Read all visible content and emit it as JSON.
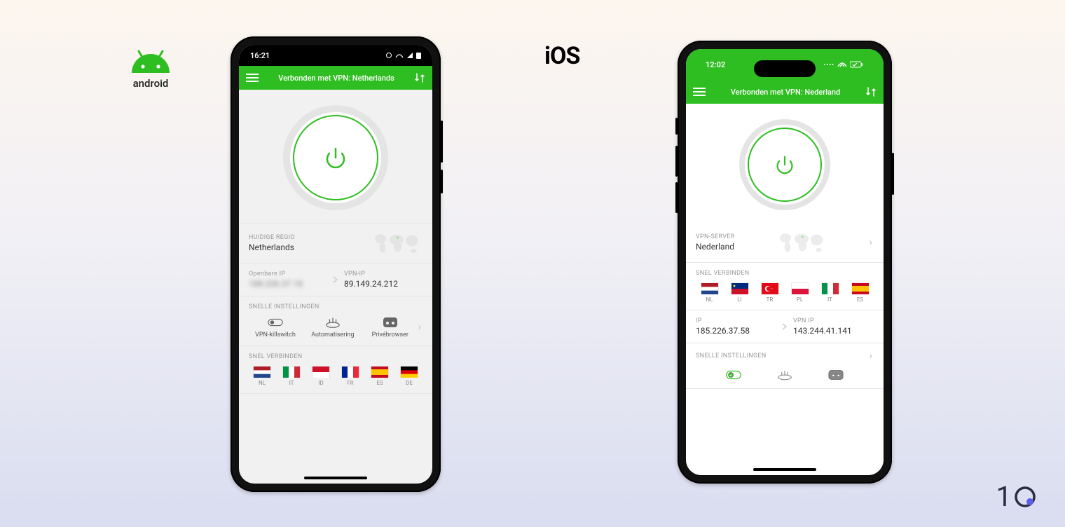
{
  "android": {
    "statusbar": {
      "time": "16:21",
      "indicators": "⌁ ▾ ▮"
    },
    "header": {
      "title": "Verbonden met VPN: Netherlands"
    },
    "region": {
      "label": "HUIDIGE REGIO",
      "value": "Netherlands"
    },
    "ip": {
      "public_label": "Openbare IP",
      "public_value": "188.206.37.18",
      "vpn_label": "VPN-IP",
      "vpn_value": "89.149.24.212"
    },
    "quick": {
      "label": "SNELLE INSTELLINGEN",
      "items": [
        {
          "name": "killswitch",
          "label": "VPN-killswitch"
        },
        {
          "name": "automation",
          "label": "Automatisering"
        },
        {
          "name": "privatebrowser",
          "label": "Privébrowser"
        }
      ]
    },
    "connect": {
      "label": "SNEL VERBINDEN",
      "flags": [
        {
          "code": "NL"
        },
        {
          "code": "IT"
        },
        {
          "code": "ID"
        },
        {
          "code": "FR"
        },
        {
          "code": "ES"
        },
        {
          "code": "DE"
        }
      ]
    }
  },
  "ios": {
    "statusbar": {
      "time": "12:02"
    },
    "header": {
      "title": "Verbonden met VPN: Nederland"
    },
    "server": {
      "label": "VPN-SERVER",
      "value": "Nederland"
    },
    "connect": {
      "label": "SNEL VERBINDEN",
      "flags": [
        {
          "code": "NL"
        },
        {
          "code": "LI"
        },
        {
          "code": "TR"
        },
        {
          "code": "PL"
        },
        {
          "code": "IT"
        },
        {
          "code": "ES"
        }
      ]
    },
    "ip": {
      "public_label": "IP",
      "public_value": "185.226.37.58",
      "vpn_label": "VPN IP",
      "vpn_value": "143.244.41.141"
    },
    "quick": {
      "label": "SNELLE INSTELLINGEN"
    }
  },
  "labels": {
    "android_logo": "android",
    "ios_logo": "iOS"
  },
  "colors": {
    "green": "#2fbe21"
  }
}
